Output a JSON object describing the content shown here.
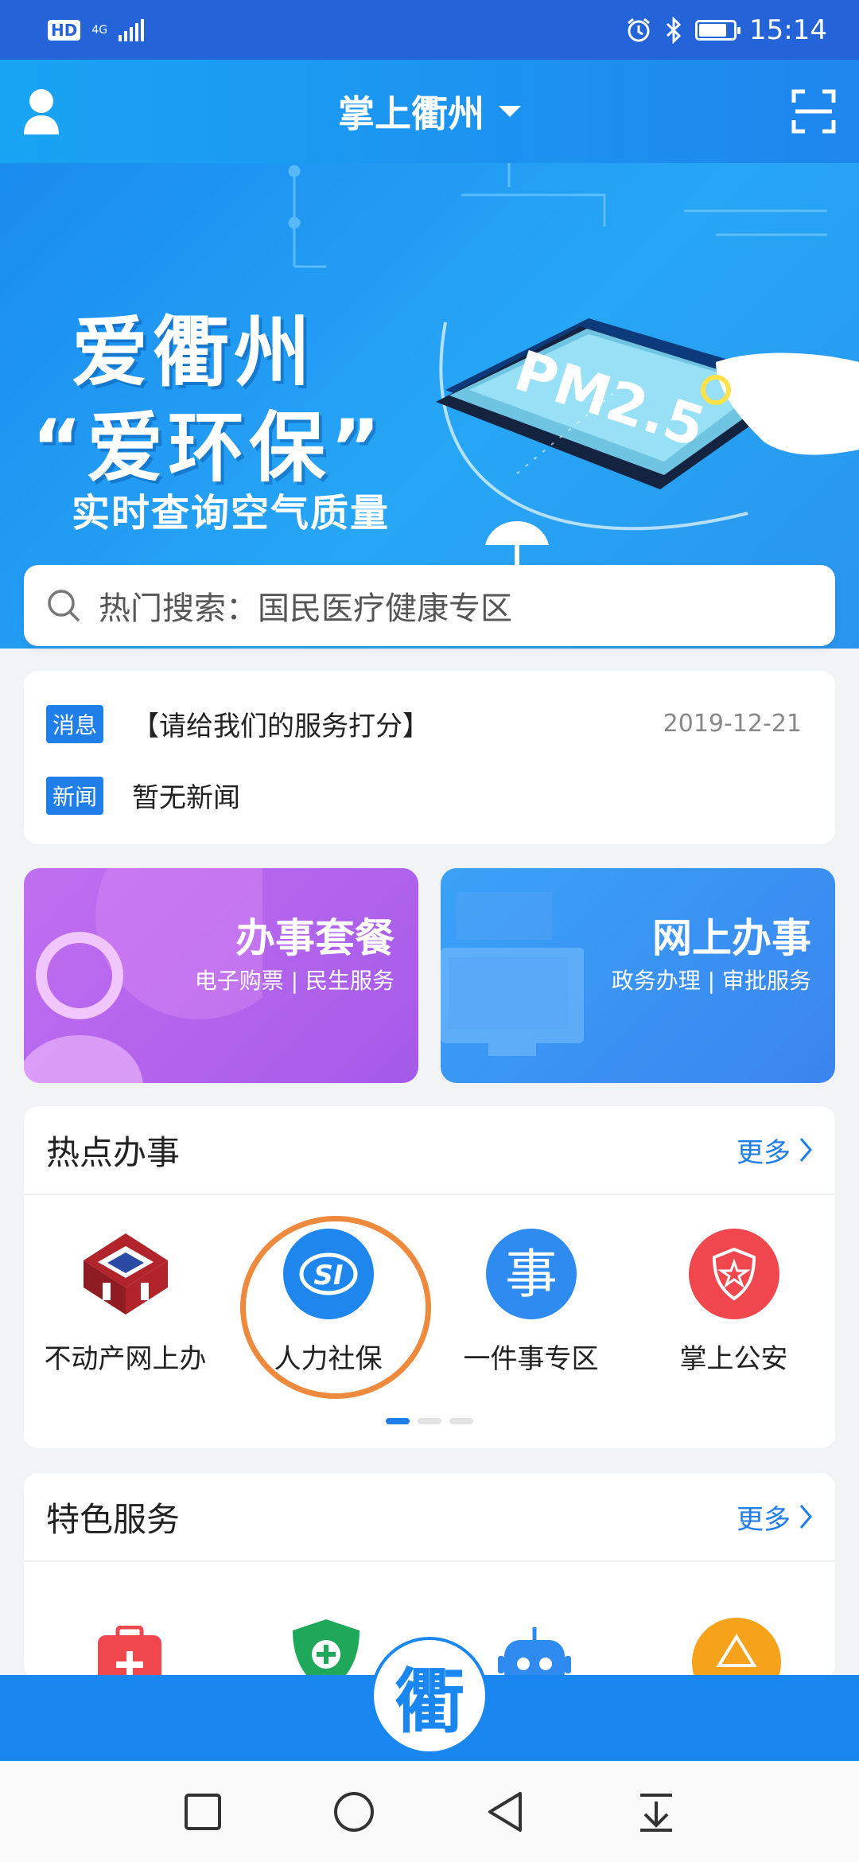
{
  "status_bar": {
    "hd": "HD",
    "network": "4G",
    "time": "15:14"
  },
  "header": {
    "title": "掌上衢州"
  },
  "banner": {
    "line1": "爱衢州",
    "line2": "“爱环保”",
    "line3": "实时查询空气质量",
    "screen_text": "PM2.5"
  },
  "search": {
    "placeholder": "热门搜索：国民医疗健康专区"
  },
  "news": {
    "rows": [
      {
        "tag": "消息",
        "text": "【请给我们的服务打分】",
        "date": "2019-12-21"
      },
      {
        "tag": "新闻",
        "text": "暂无新闻",
        "date": ""
      }
    ]
  },
  "tiles": [
    {
      "title": "办事套餐",
      "subtitle": "电子购票 | 民生服务"
    },
    {
      "title": "网上办事",
      "subtitle": "政务办理 | 审批服务"
    }
  ],
  "hot": {
    "title": "热点办事",
    "more": "更多",
    "items": [
      {
        "label": "不动产网上办"
      },
      {
        "label": "人力社保"
      },
      {
        "label": "一件事专区"
      },
      {
        "label": "掌上公安"
      }
    ],
    "pages": 3,
    "current_page": 1
  },
  "special": {
    "title": "特色服务",
    "more": "更多"
  },
  "center_logo": "衢",
  "colors": {
    "primary": "#1f7ee8",
    "header_start": "#19a4f3",
    "status_bar": "#2463d8",
    "highlight": "#ee8a3d"
  }
}
